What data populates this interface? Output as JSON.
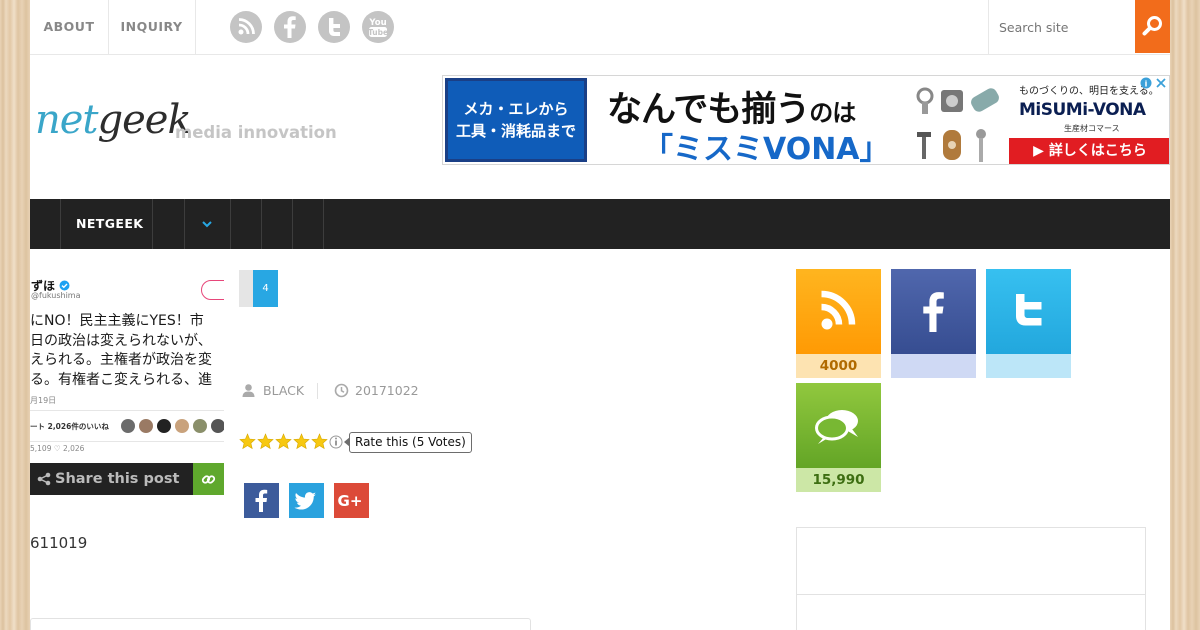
{
  "topbar": {
    "links": [
      "ABOUT",
      "INQUIRY"
    ],
    "social_icons": [
      "rss-icon",
      "facebook-icon",
      "twitter-icon",
      "youtube-icon"
    ],
    "search_placeholder": "Search site"
  },
  "header": {
    "logo_part1": "net",
    "logo_part2": "geek",
    "tagline": "media innovation"
  },
  "ad": {
    "left_line1": "メカ・エレから",
    "left_line2": "工具・消耗品まで",
    "headline_main": "なんでも揃う",
    "headline_suffix": "のは",
    "brand": "「ミスミVONA」",
    "right_small": "ものづくりの、明日を支える。",
    "right_logo": "MiSUMi-VONA",
    "right_sub": "生産材コマース",
    "cta": "▶ 詳しくはこちら"
  },
  "nav": {
    "item": "NETGEEK",
    "dropdown_icon": "chevron-down-icon"
  },
  "thumbnail": {
    "name": "ずほ",
    "handle": "@fukushima",
    "text_lines": [
      "にNO！民主主義にYES！市",
      "日の政治は変えられないが、",
      "えられる。主権者が政治を変",
      "る。有権者こ変えられる、進"
    ],
    "date": "月19日",
    "likes_text": "ート  2,026件のいいね",
    "icon_counts": "5,109   ♡ 2,026"
  },
  "share": {
    "label": "Share this post",
    "link_icon": "link-icon"
  },
  "post": {
    "tag_number": "4",
    "author": "BLACK",
    "date": "20171022",
    "rating_stars": 5,
    "rating_label": "Rate this (5 Votes)",
    "counter": "611019"
  },
  "share_buttons": [
    "facebook-icon",
    "twitter-icon",
    "google-plus-icon"
  ],
  "sidebar": {
    "rss_count": "4000",
    "facebook_count": "",
    "twitter_count": "",
    "feedly_count": "15,990"
  },
  "colors": {
    "accent": "#f26c1b",
    "nav": "#222222",
    "link_blue": "#28a7e3",
    "star": "#f7c811"
  }
}
